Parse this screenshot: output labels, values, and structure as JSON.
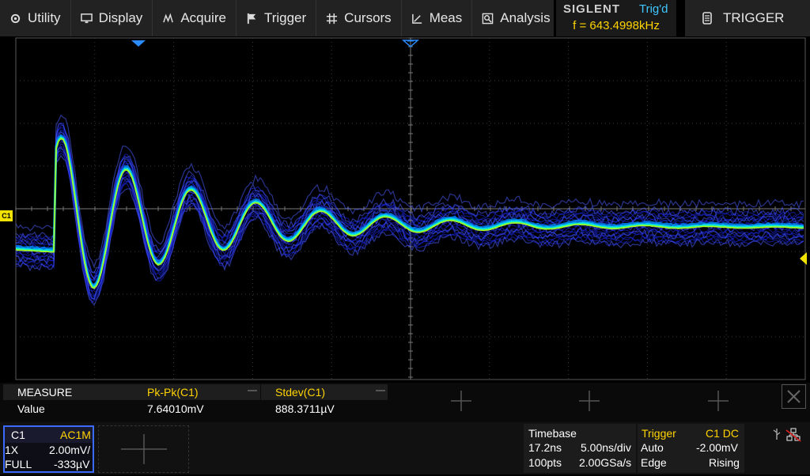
{
  "menu": [
    {
      "label": "Utility",
      "icon": "gear-icon"
    },
    {
      "label": "Display",
      "icon": "monitor-icon"
    },
    {
      "label": "Acquire",
      "icon": "acquire-icon"
    },
    {
      "label": "Trigger",
      "icon": "flag-icon"
    },
    {
      "label": "Cursors",
      "icon": "cursor-grid-icon"
    },
    {
      "label": "Meas",
      "icon": "ruler-icon"
    },
    {
      "label": "Analysis",
      "icon": "analysis-icon"
    }
  ],
  "status": {
    "brand": "SIGLENT",
    "trig_state": "Trig'd",
    "frequency": "f = 643.4998kHz"
  },
  "trigger_tab": {
    "label": "TRIGGER",
    "icon": "trigger-doc-icon"
  },
  "channel_marker": "C1",
  "measure": {
    "header": "MEASURE",
    "row_label": "Value",
    "items": [
      {
        "name": "Pk-Pk(C1)",
        "value": "7.64010mV"
      },
      {
        "name": "Stdev(C1)",
        "value": "888.3711µV"
      }
    ]
  },
  "channel": {
    "name": "C1",
    "coupling": "AC1M",
    "probe": "1X",
    "scale": "2.00mV/",
    "bandwidth": "FULL",
    "offset": "-333µV"
  },
  "timebase": {
    "title": "Timebase",
    "delay": "17.2ns",
    "scale": "5.00ns/div",
    "points": "100pts",
    "rate": "2.00GSa/s"
  },
  "trigger": {
    "title": "Trigger",
    "source": "C1 DC",
    "mode": "Auto",
    "level": "-2.00mV",
    "type": "Edge",
    "slope": "Rising"
  },
  "colors": {
    "accent": "#3a6aff",
    "trace_core": "#aaff20",
    "trace_mid": "#00d0ff",
    "trace_outer": "#1e2cff",
    "trigger_yellow": "#ffd400",
    "trig_status": "#3ec8ff"
  }
}
